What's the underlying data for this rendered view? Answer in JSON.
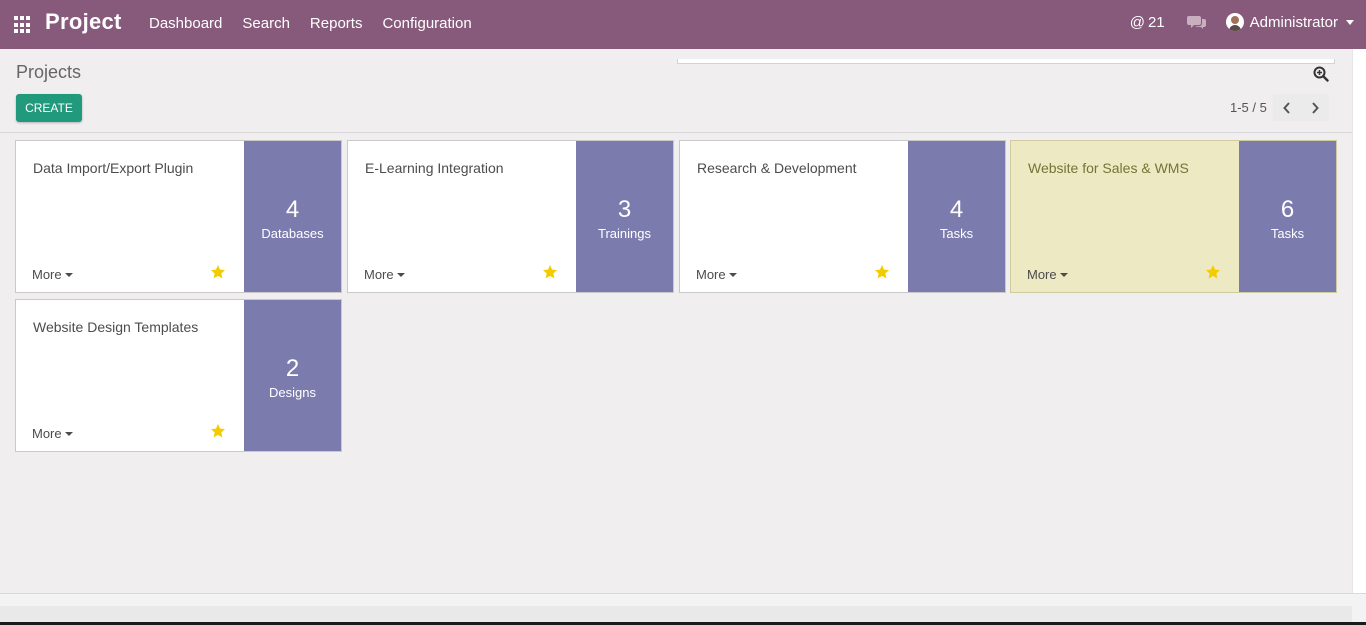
{
  "navbar": {
    "app_title": "Project",
    "menu": [
      "Dashboard",
      "Search",
      "Reports",
      "Configuration"
    ],
    "activity_count": "21",
    "user_name": "Administrator",
    "background_color": "#875a7b"
  },
  "control_panel": {
    "breadcrumb": "Projects",
    "create_label": "CREATE",
    "pager": "1-5 / 5"
  },
  "projects": [
    {
      "name": "Data Import/Export Plugin",
      "count": "4",
      "label": "Databases",
      "more": "More"
    },
    {
      "name": "E-Learning Integration",
      "count": "3",
      "label": "Trainings",
      "more": "More"
    },
    {
      "name": "Research & Development",
      "count": "4",
      "label": "Tasks",
      "more": "More"
    },
    {
      "name": "Website for Sales & WMS",
      "count": "6",
      "label": "Tasks",
      "more": "More",
      "highlight_color": "#ece9c3"
    },
    {
      "name": "Website Design Templates",
      "count": "2",
      "label": "Designs",
      "more": "More"
    }
  ],
  "icons": {
    "apps": "grid-icon",
    "activity": "at-icon",
    "chat": "chat-icon",
    "search": "magnifier-icon",
    "favorite": "star-icon"
  },
  "colors": {
    "side_panel": "#7c7bad",
    "star": "#f3cc00",
    "create_button": "#21997d"
  }
}
